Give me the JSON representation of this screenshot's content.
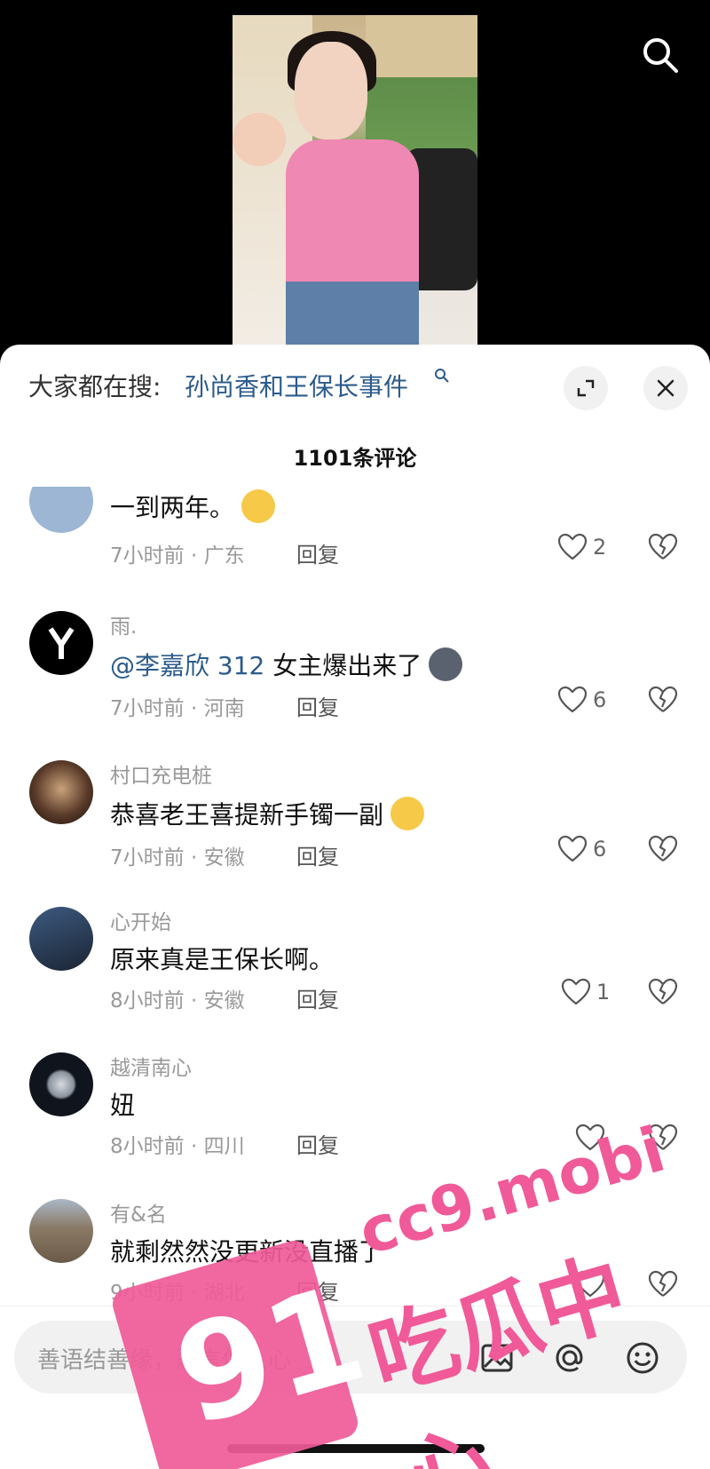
{
  "sheet": {
    "trending_prefix": "大家都在搜:",
    "trending_query": "孙尚香和王保长事件",
    "comment_count": "1101条评论"
  },
  "comments": [
    {
      "username": "",
      "text": "一到两年。",
      "time": "7小时前",
      "location": "广东",
      "reply": "回复",
      "likes": "2",
      "avatar_color": "#7b9bbf"
    },
    {
      "username": "雨.",
      "mention": "@李嘉欣 312",
      "text": "女主爆出来了",
      "time": "7小时前",
      "location": "河南",
      "reply": "回复",
      "likes": "6",
      "avatar_color": "#000000"
    },
    {
      "username": "村口充电桩",
      "text": "恭喜老王喜提新手镯一副",
      "time": "7小时前",
      "location": "安徽",
      "reply": "回复",
      "likes": "6",
      "avatar_color": "#5a3b2a"
    },
    {
      "username": "心开始",
      "text": "原来真是王保长啊。",
      "time": "8小时前",
      "location": "安徽",
      "reply": "回复",
      "likes": "1",
      "avatar_color": "#2c3d55"
    },
    {
      "username": "越清南心",
      "text": "妞",
      "time": "8小时前",
      "location": "四川",
      "reply": "回复",
      "likes": "",
      "avatar_color": "#10141c"
    },
    {
      "username": "有&名",
      "text": "就剩然然没更新没直播了",
      "time": "9小时前",
      "location": "湖北",
      "reply": "回复",
      "likes": "",
      "avatar_color": "#8a7a66"
    }
  ],
  "input": {
    "placeholder": "善语结善缘，恶言伤人心"
  },
  "watermark": {
    "number": "91",
    "domain": "cc9.mobi",
    "name": "吃瓜中心"
  },
  "colors": {
    "link": "#2b5b8c",
    "watermark": "#f05a98"
  },
  "icons": [
    "search-icon",
    "expand-icon",
    "close-icon",
    "heart-icon",
    "dislike-icon",
    "image-icon",
    "at-icon",
    "emoji-icon"
  ]
}
